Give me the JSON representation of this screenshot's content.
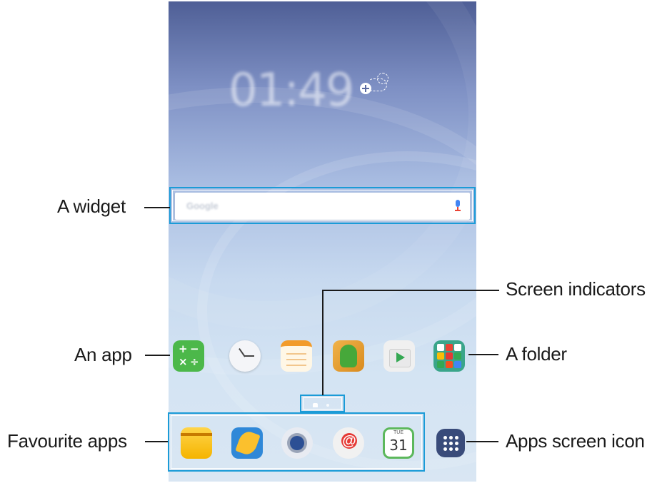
{
  "callouts": {
    "widget": "A widget",
    "app": "An app",
    "favourites": "Favourite apps",
    "indicators": "Screen indicators",
    "folder": "A folder",
    "apps_icon": "Apps screen icon"
  },
  "home_screen": {
    "clock": "01:49",
    "date": "",
    "search_hint": "",
    "app_row": [
      {
        "name": "calculator-icon"
      },
      {
        "name": "clock-icon"
      },
      {
        "name": "memo-icon"
      },
      {
        "name": "kids-mode-icon"
      },
      {
        "name": "play-store-icon"
      },
      {
        "name": "google-folder-icon"
      }
    ],
    "dock": [
      {
        "name": "my-files-icon"
      },
      {
        "name": "gallery-icon"
      },
      {
        "name": "camera-icon"
      },
      {
        "name": "email-icon"
      },
      {
        "name": "calendar-icon",
        "day": "TUE",
        "date": "31"
      },
      {
        "name": "apps-grid-icon"
      }
    ]
  },
  "colors": {
    "highlight": "#1b9bd7",
    "text": "#1a1a1a"
  }
}
